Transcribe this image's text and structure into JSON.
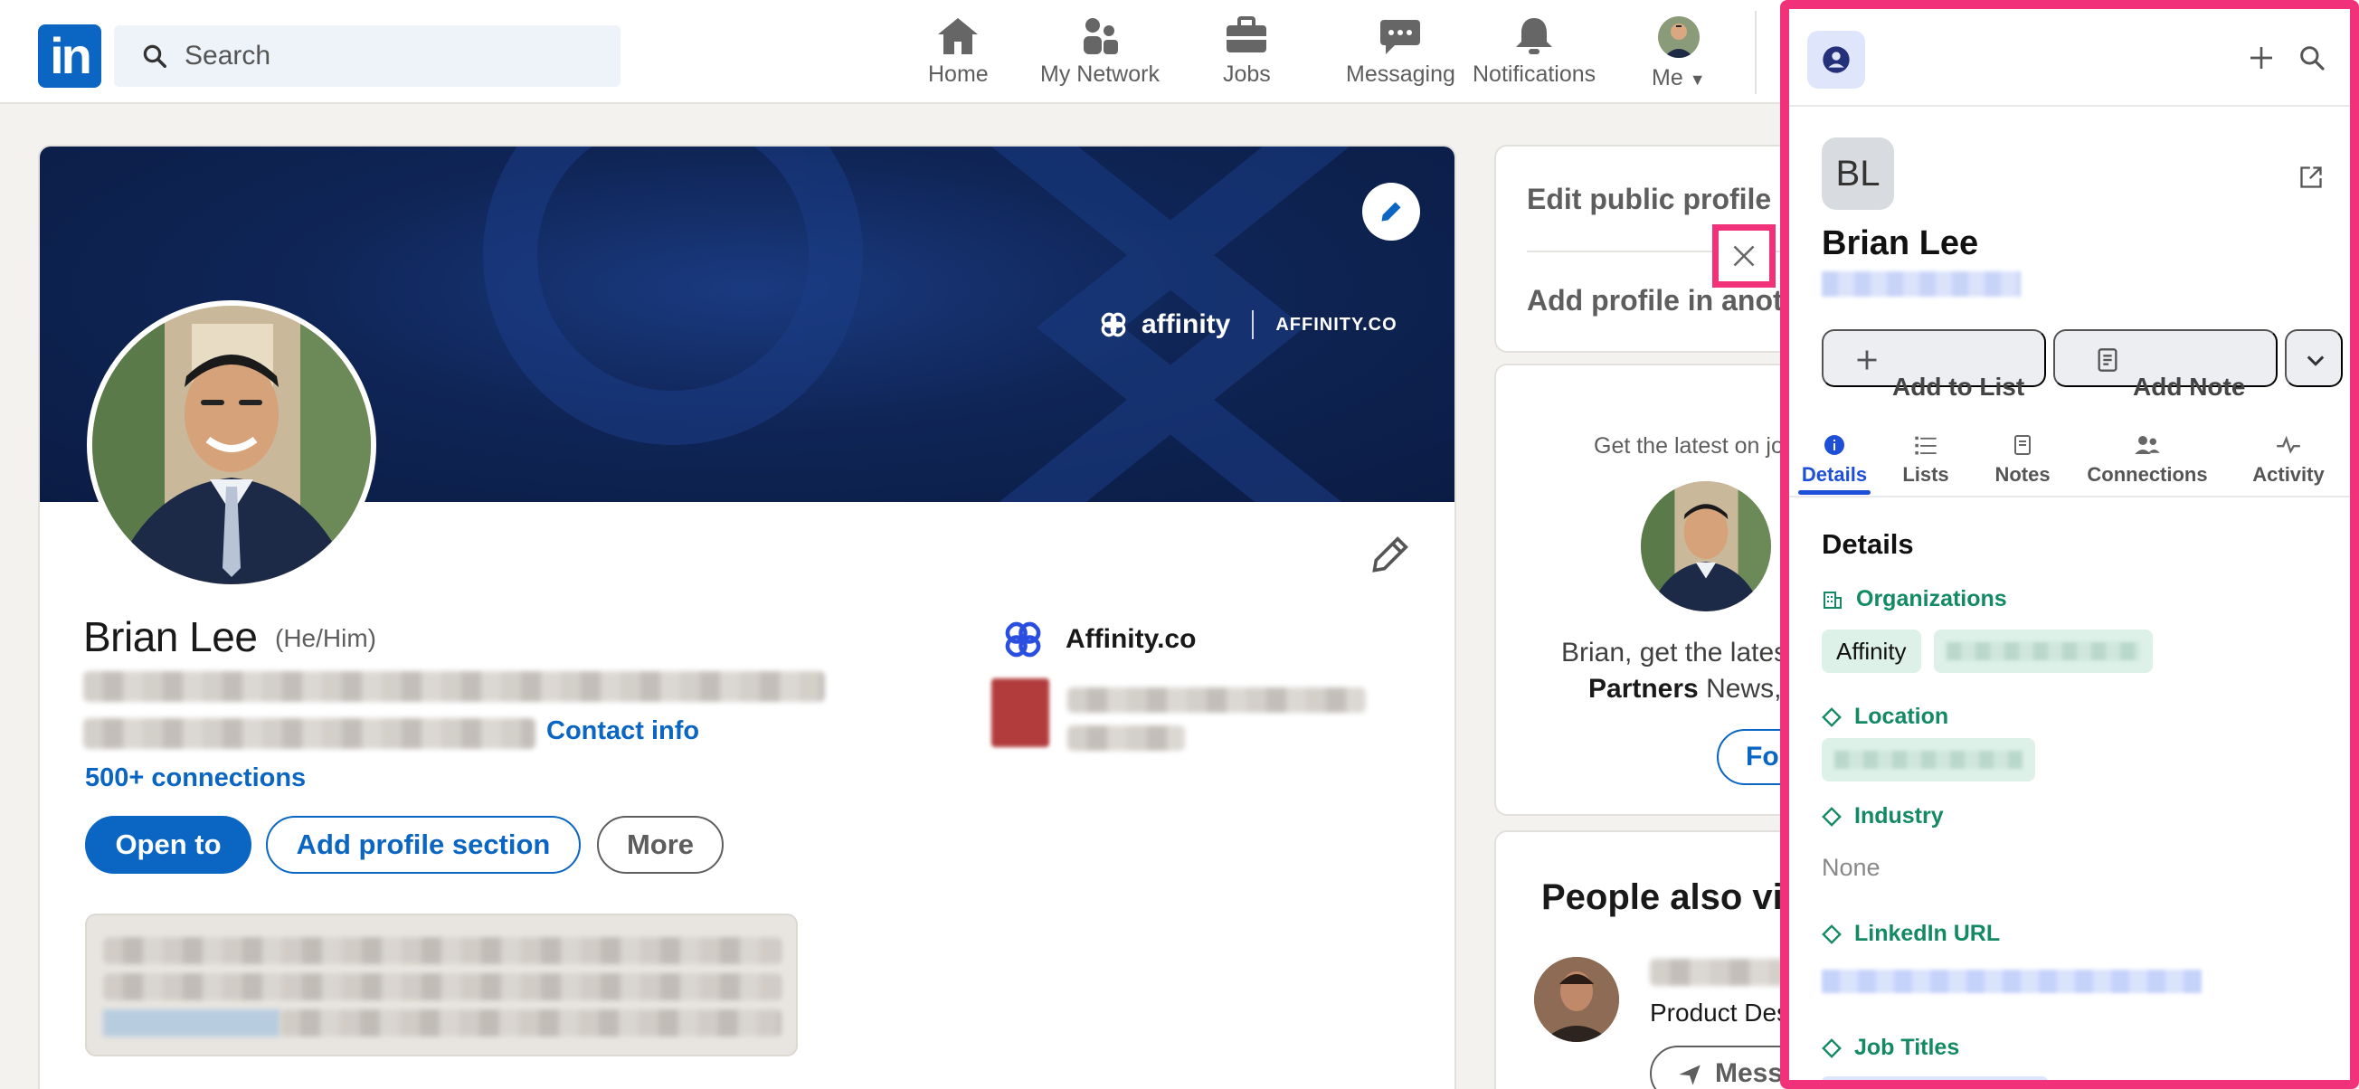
{
  "nav": {
    "logo": "in",
    "search_placeholder": "Search",
    "items": [
      {
        "label": "Home"
      },
      {
        "label": "My Network"
      },
      {
        "label": "Jobs"
      },
      {
        "label": "Messaging"
      },
      {
        "label": "Notifications"
      },
      {
        "label": "Me"
      }
    ]
  },
  "profile": {
    "banner_brand": "affinity",
    "banner_domain": "AFFINITY.CO",
    "name": "Brian Lee",
    "pronouns": "(He/Him)",
    "contact_info": "Contact info",
    "connections": "500+ connections",
    "buttons": {
      "open_to": "Open to",
      "add_section": "Add profile section",
      "more": "More"
    },
    "company": "Affinity.co"
  },
  "right": {
    "edit_public": "Edit public profile & URL",
    "add_language": "Add profile in another language",
    "get_latest": "Get the latest on jobs",
    "news_line1": "Brian, get the latest",
    "news_line2_bold": "Partners",
    "news_line2_rest": " News,",
    "follow": "Follow",
    "people_title": "People also viewed",
    "people_sub": "Product Designer",
    "message": "Message"
  },
  "panel": {
    "initials": "BL",
    "name": "Brian Lee",
    "actions": {
      "add_to_list": "Add to List",
      "add_note": "Add Note"
    },
    "tabs": [
      {
        "label": "Details"
      },
      {
        "label": "Lists"
      },
      {
        "label": "Notes"
      },
      {
        "label": "Connections"
      },
      {
        "label": "Activity"
      }
    ],
    "details_heading": "Details",
    "fields": {
      "organizations": "Organizations",
      "organization_value": "Affinity",
      "location": "Location",
      "industry": "Industry",
      "industry_value": "None",
      "linkedin_url": "LinkedIn URL",
      "job_titles": "Job Titles"
    }
  },
  "colors": {
    "linkedin_blue": "#0a66c2",
    "highlight_pink": "#f2317b",
    "affinity_green": "#138a63",
    "affinity_blue": "#1e4fd8"
  }
}
